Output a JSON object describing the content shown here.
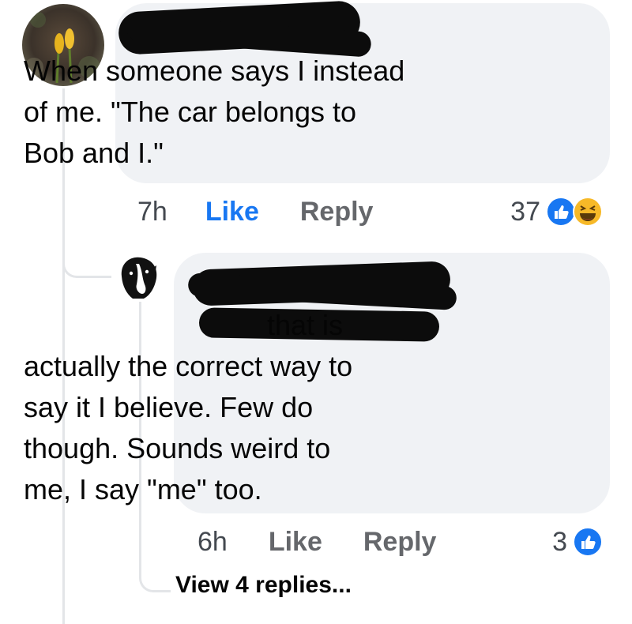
{
  "comments": [
    {
      "text_lines": [
        "When someone says I instead",
        "of me.   \"The car belongs to",
        "Bob and I.\""
      ],
      "time": "7h",
      "like_label": "Like",
      "reply_label": "Reply",
      "reaction_count": "37",
      "reaction_icons": [
        "like-icon",
        "haha-icon"
      ]
    },
    {
      "text_lines": [
        "that is",
        "actually the correct way to",
        "say it I believe. Few do",
        "though. Sounds weird to",
        "me, I say \"me\" too."
      ],
      "time": "6h",
      "like_label": "Like",
      "reply_label": "Reply",
      "reaction_count": "3",
      "reaction_icons": [
        "like-icon"
      ]
    }
  ],
  "view_replies_label": "View 4 replies...",
  "colors": {
    "bubble": "#f0f2f5",
    "like_blue": "#1877f2",
    "secondary_text": "#65676b",
    "haha_yellow": "#f7b928"
  }
}
